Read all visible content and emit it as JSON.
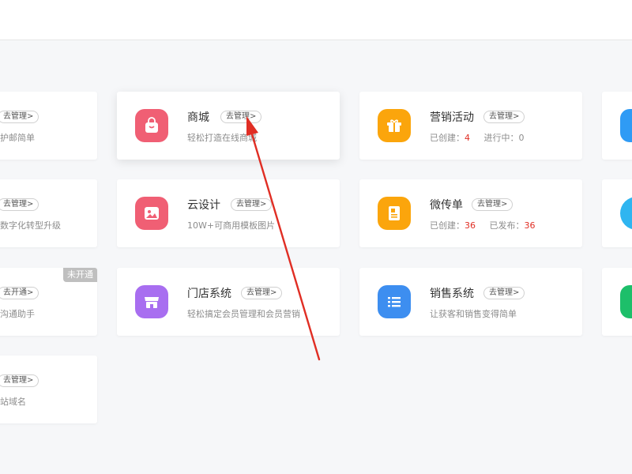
{
  "cards": {
    "left1": {
      "pill": "去管理>",
      "desc": "护邮简单"
    },
    "left2": {
      "pill": "去管理>",
      "desc": "数字化转型升级"
    },
    "left3": {
      "pill": "去开通>",
      "desc": "沟通助手",
      "badge": "未开通"
    },
    "left4": {
      "pill": "去管理>",
      "desc": "站域名"
    },
    "mall": {
      "title": "商城",
      "pill": "去管理>",
      "desc": "轻松打造在线商城",
      "icon": "shopping-bag-icon",
      "color": "#f05f74"
    },
    "design": {
      "title": "云设计",
      "pill": "去管理>",
      "desc": "10W+可商用模板图片",
      "icon": "image-icon",
      "color": "#f05f74"
    },
    "store": {
      "title": "门店系统",
      "pill": "去管理>",
      "desc": "轻松搞定会员管理和会员营销",
      "icon": "storefront-icon",
      "color": "#a86ef0"
    },
    "marketing": {
      "title": "营销活动",
      "pill": "去管理>",
      "created_label": "已创建：",
      "created_value": "4",
      "running_label": "进行中：",
      "running_value": "0",
      "icon": "gift-icon",
      "color": "#fba50c"
    },
    "flyer": {
      "title": "微传单",
      "pill": "去管理>",
      "created_label": "已创建：",
      "created_value": "36",
      "published_label": "已发布：",
      "published_value": "36",
      "icon": "flyer-icon",
      "color": "#fba50c"
    },
    "sales": {
      "title": "销售系统",
      "pill": "去管理>",
      "desc": "让获客和销售变得简单",
      "icon": "list-icon",
      "color": "#3d8ef0"
    }
  },
  "right_edge_icons": [
    "#2f9bf5",
    "#2fb5f0",
    "#1dbf6a"
  ],
  "annotation": {
    "arrow_color": "#e02e24"
  }
}
